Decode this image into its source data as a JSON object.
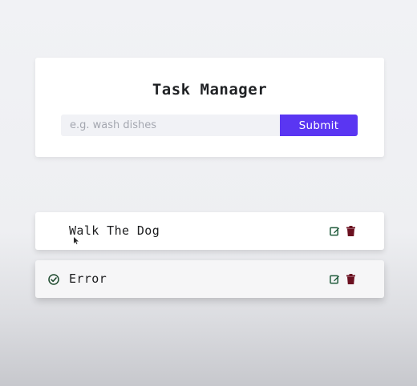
{
  "app": {
    "title": "Task Manager"
  },
  "form": {
    "input_placeholder": "e.g. wash dishes",
    "input_value": "",
    "submit_label": "Submit"
  },
  "tasks": [
    {
      "text": "Walk The Dog",
      "completed": false
    },
    {
      "text": "Error",
      "completed": true
    }
  ],
  "icons": {
    "check": "check-circle-icon",
    "edit": "edit-icon",
    "delete": "trash-icon"
  },
  "colors": {
    "accent": "#5a36f2",
    "edit_icon": "#1e5a3a",
    "delete_icon": "#6b1020",
    "check_icon": "#1e4a2e"
  }
}
